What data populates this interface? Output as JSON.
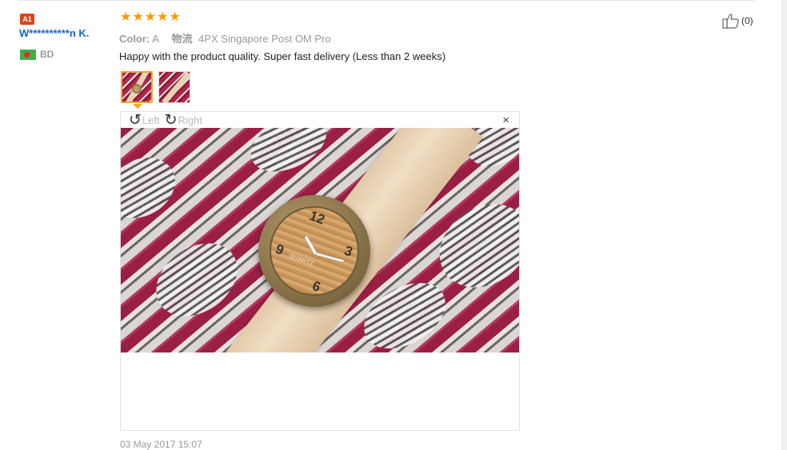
{
  "review": {
    "badge": "A1",
    "user_name": "W**********n K.",
    "country_code": "BD",
    "rating_stars": "★★★★★",
    "rating": 5,
    "color_label": "Color:",
    "color_value": "A",
    "shipping_label": "物流",
    "shipping_value": "4PX Singapore Post OM Pro",
    "text": "Happy with the product quality. Super fast delivery (Less than 2 weeks)",
    "date": "03 May 2017 15:07",
    "like_count": "(0)"
  },
  "viewer": {
    "rotate_left_label": "Left",
    "rotate_right_label": "Right",
    "close_symbol": "×",
    "watch_numerals": [
      "12",
      "3",
      "6",
      "9"
    ],
    "watch_brand": "QUARTZ"
  },
  "colors": {
    "accent_orange": "#ff9900",
    "link_blue": "#1a62c5",
    "badge_red": "#e04216"
  },
  "icons": {
    "rotate_left": "rotate-left-icon",
    "rotate_right": "rotate-right-icon",
    "close": "close-icon",
    "like": "thumbs-up-icon",
    "flag": "bangladesh-flag-icon"
  }
}
